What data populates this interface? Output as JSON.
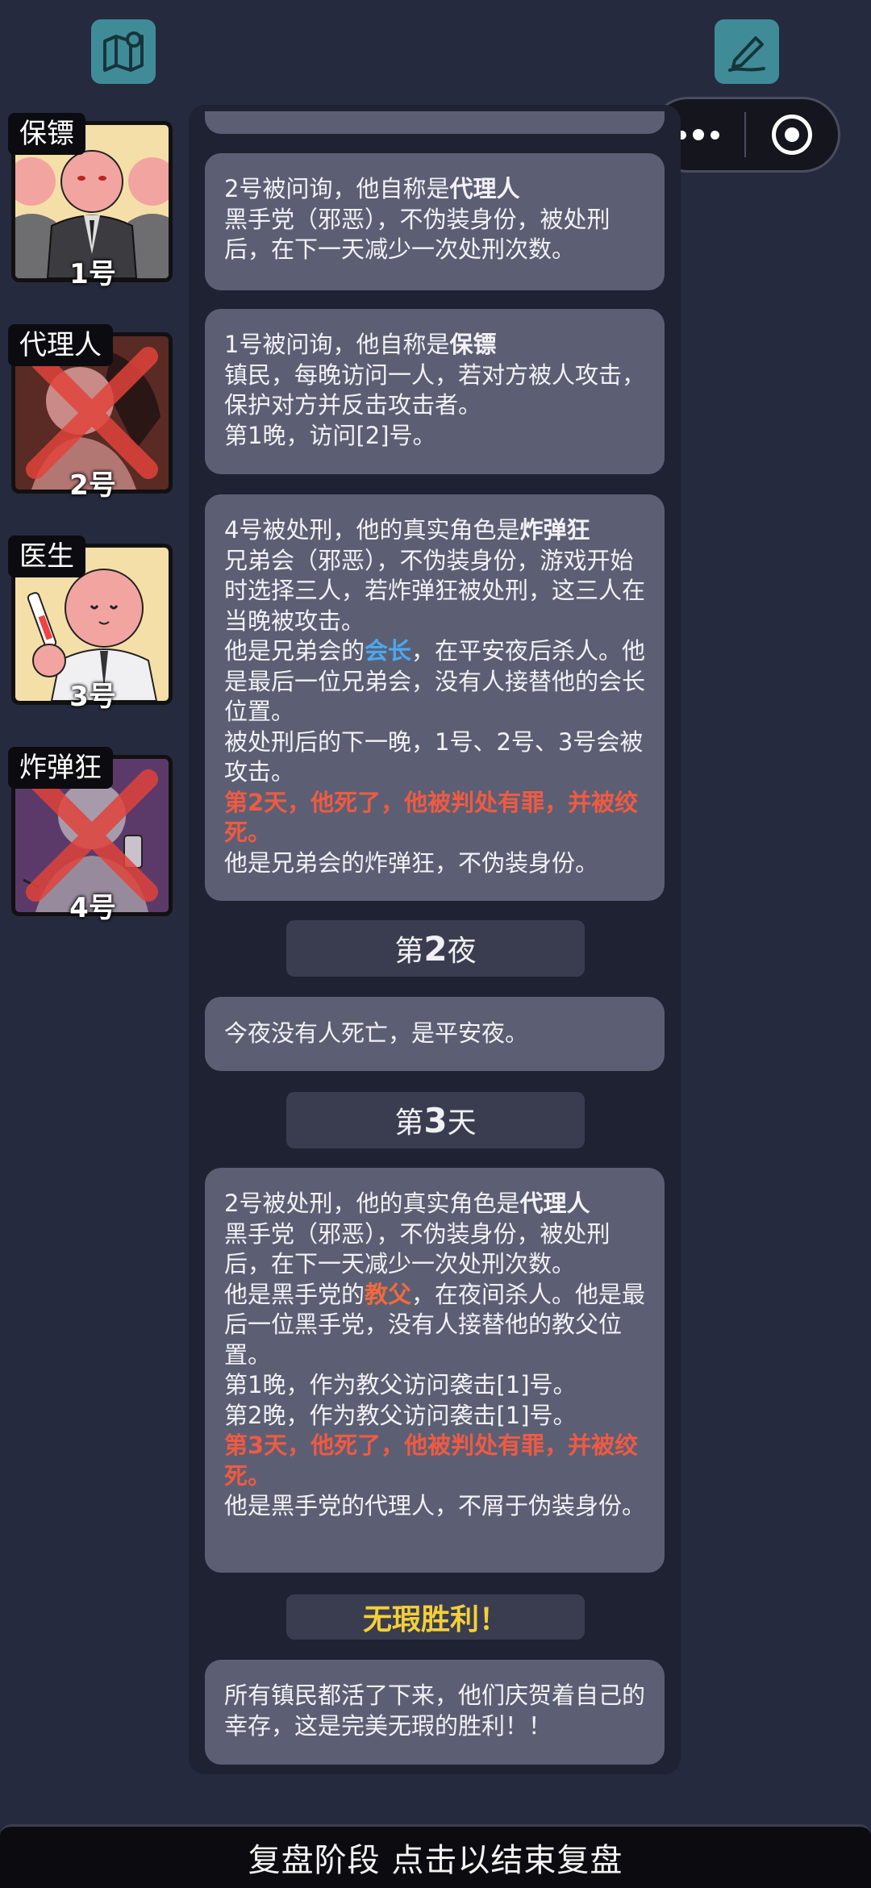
{
  "top_icons": {
    "left": "map-icon",
    "right": "pen-icon"
  },
  "players": [
    {
      "role": "保镖",
      "number": "1号",
      "eliminated": false
    },
    {
      "role": "代理人",
      "number": "2号",
      "eliminated": true
    },
    {
      "role": "医生",
      "number": "3号",
      "eliminated": false
    },
    {
      "role": "炸弹狂",
      "number": "4号",
      "eliminated": true
    }
  ],
  "messages": {
    "m1": {
      "line1_prefix": "2号被问询，他自称是",
      "line1_role": "代理人",
      "body": "黑手党（邪恶），不伪装身份，被处刑后，在下一天减少一次处刑次数。"
    },
    "m2": {
      "line1_prefix": "1号被问询，他自称是",
      "line1_role": "保镖",
      "body": "镇民，每晚访问一人，若对方被人攻击，保护对方并反击攻击者。",
      "extra": "第1晚，访问[2]号。"
    },
    "m3": {
      "line1_prefix": "4号被处刑，他的真实角色是",
      "line1_role": "炸弹狂",
      "body": "兄弟会（邪恶），不伪装身份，游戏开始时选择三人，若炸弹狂被处刑，这三人在当晚被攻击。",
      "leader_prefix": "他是兄弟会的",
      "leader_title": "会长",
      "leader_suffix": "，在平安夜后杀人。他是最后一位兄弟会，没有人接替他的会长位置。",
      "after": "被处刑后的下一晚，1号、2号、3号会被攻击。",
      "death": "第2天，他死了，他被判处有罪，并被绞死。",
      "closing": "他是兄弟会的炸弹狂，不伪装身份。"
    },
    "m4": {
      "text": "今夜没有人死亡，是平安夜。"
    },
    "m5": {
      "line1_prefix": "2号被处刑，他的真实角色是",
      "line1_role": "代理人",
      "body": "黑手党（邪恶），不伪装身份，被处刑后，在下一天减少一次处刑次数。",
      "leader_prefix": "他是黑手党的",
      "leader_title": "教父",
      "leader_suffix": "，在夜间杀人。他是最后一位黑手党，没有人接替他的教父位置。",
      "night1": "第1晚，作为教父访问袭击[1]号。",
      "night2": "第2晚，作为教父访问袭击[1]号。",
      "death": "第3天，他死了，他被判处有罪，并被绞死。",
      "closing": "他是黑手党的代理人，不屑于伪装身份。"
    },
    "m6": {
      "text": "所有镇民都活了下来，他们庆贺着自己的幸存，这是完美无瑕的胜利！！"
    }
  },
  "headers": {
    "night2_prefix": "第",
    "night2_num": "2",
    "night2_suffix": "夜",
    "day3_prefix": "第",
    "day3_num": "3",
    "day3_suffix": "天",
    "victory": "无瑕胜利！"
  },
  "bottom_bar": "复盘阶段 点击以结束复盘",
  "colors": {
    "accent_red": "#ef5a43",
    "accent_blue": "#4aa8f0",
    "victory_yellow": "#f3cf3a",
    "icon_teal": "#3f8c98"
  }
}
